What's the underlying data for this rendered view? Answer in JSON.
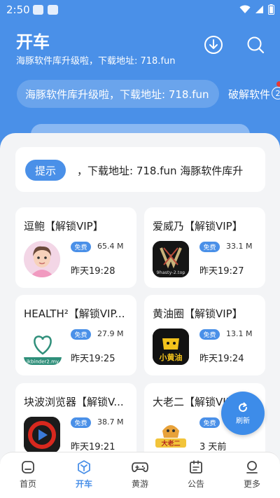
{
  "status_bar": {
    "time": "2:50"
  },
  "header": {
    "title": "开车",
    "subtitle": "海豚软件库升级啦，下载地址: 718.fun",
    "download_icon": "download-icon",
    "search_icon": "search-icon"
  },
  "marquee": {
    "current": "海豚软件库升级啦，下载地址: 718.fun",
    "next": "破解软件",
    "badge": "2"
  },
  "notice": {
    "tag": "提示",
    "text": "，下载地址: 718.fun   海豚软件库升"
  },
  "apps": [
    {
      "title": "逗鲍【解锁VIP】",
      "tag": "免费",
      "size": "65.4 M",
      "date": "昨天19:28"
    },
    {
      "title": "爱威乃【解锁VIP】",
      "tag": "免费",
      "size": "33.1 M",
      "date": "昨天19:27",
      "icon_text": "9hasty-2.top"
    },
    {
      "title": "HEALTH²【解锁VIP...",
      "tag": "免费",
      "size": "27.9 M",
      "date": "昨天19:25",
      "icon_text": "jkbinder2.my"
    },
    {
      "title": "黄油圈【解锁VIP】",
      "tag": "免费",
      "size": "13.1 M",
      "date": "昨天19:24",
      "icon_text": "小黄油"
    },
    {
      "title": "块波浏览器【解锁V...",
      "tag": "免费",
      "size": "38.7 M",
      "date": "昨天19:21"
    },
    {
      "title": "大老二【解锁VIP】",
      "tag": "免费",
      "size": "",
      "date": "3 天前",
      "icon_text": "大老二"
    }
  ],
  "refresh": {
    "label": "刷新"
  },
  "tabs": [
    {
      "label": "首页",
      "icon": "home-icon"
    },
    {
      "label": "开车",
      "icon": "drive-icon",
      "active": true
    },
    {
      "label": "黄游",
      "icon": "gamepad-icon"
    },
    {
      "label": "公告",
      "icon": "announcement-icon"
    },
    {
      "label": "更多",
      "icon": "more-icon"
    }
  ],
  "colors": {
    "primary": "#4a90e8",
    "background": "#f3f4f6",
    "card": "#ffffff"
  }
}
